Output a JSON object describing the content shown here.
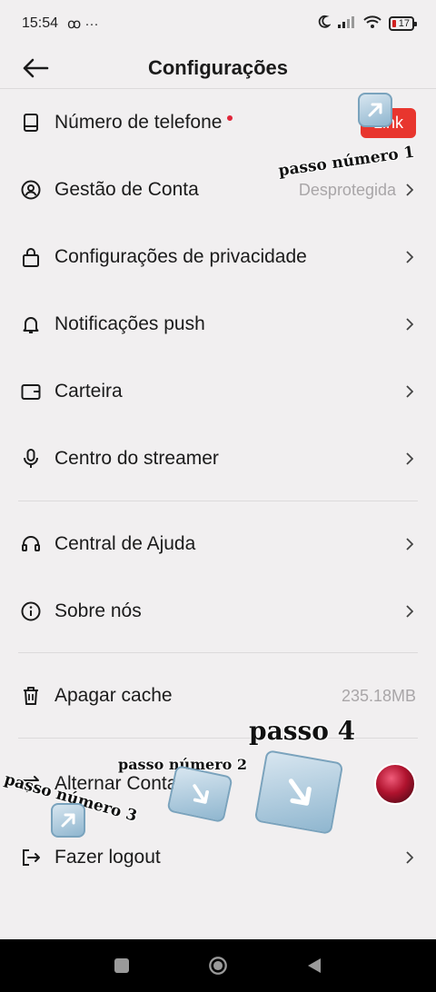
{
  "status_bar": {
    "time": "15:54",
    "extra": "4§ •••",
    "battery": "17"
  },
  "header": {
    "title": "Configurações"
  },
  "rows": [
    {
      "label": "Número de telefone",
      "value": "",
      "action": "Link"
    },
    {
      "label": "Gestão de Conta",
      "value": "Desprotegida"
    },
    {
      "label": "Configurações de privacidade",
      "value": ""
    },
    {
      "label": "Notificações push",
      "value": ""
    },
    {
      "label": "Carteira",
      "value": ""
    },
    {
      "label": "Centro do streamer",
      "value": ""
    },
    {
      "label": "Central de Ajuda",
      "value": ""
    },
    {
      "label": "Sobre nós",
      "value": ""
    },
    {
      "label": "Apagar cache",
      "value": "235.18MB"
    },
    {
      "label": "Alternar Conta",
      "value": ""
    },
    {
      "label": "Fazer logout",
      "value": ""
    }
  ],
  "overlays": {
    "step1": "passo número 1",
    "step2": "passo número 2",
    "step3": "passo número 3",
    "step4": "passo 4"
  },
  "colors": {
    "accent": "#e8362e",
    "background": "#f1eff0"
  }
}
